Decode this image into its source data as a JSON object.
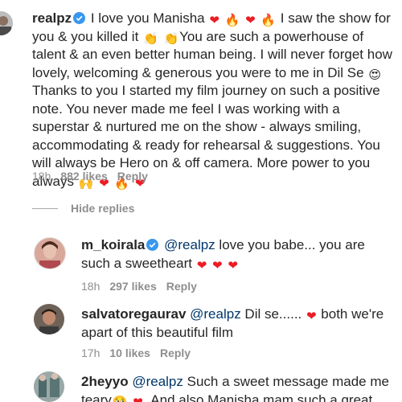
{
  "comment_main": {
    "username": "realpz",
    "body_1": " I love you Manisha ",
    "body_2": " I saw the show for you & you killed it ",
    "body_3": "You are such a powerhouse of talent & an even better human being. I will never forget how lovely, welcoming & generous you were to me in Dil Se ",
    "body_4": "Thanks to you I started my film journey on such a positive note. You never made me feel I was working with a superstar & nurtured me on the show - always smiling, accommodating & ready for rehearsal & suggestions. You will always be Hero on & off camera. More power to you always ",
    "time": "18h",
    "likes": "882 likes",
    "reply": "Reply"
  },
  "hide_replies": "Hide replies",
  "replies": [
    {
      "username": "m_koirala",
      "mention": "@realpz",
      "body": " love you babe... you are such a sweetheart ",
      "time": "18h",
      "likes": "297 likes",
      "reply": "Reply"
    },
    {
      "username": "salvatoregaurav",
      "mention": "@realpz",
      "body_1": " Dil se...... ",
      "body_2": " both we're apart of this beautiful film",
      "time": "17h",
      "likes": "10 likes",
      "reply": "Reply"
    },
    {
      "username": "2heyyo",
      "mention": "@realpz",
      "body_1": " Such a sweet message made me teary",
      "body_2": ". And also Manisha mam such a great"
    }
  ],
  "icons": {
    "heart": "heart-emoji",
    "fire": "fire-emoji",
    "clap": "clapping-hands-emoji",
    "heart_eyes": "smiling-face-with-heart-eyes-emoji",
    "raised_hands": "raising-hands-emoji",
    "teary": "teary-face-emoji",
    "verified": "verified-badge-icon"
  },
  "colors": {
    "heart": "#ed1c24",
    "fire": "#f7931e",
    "mention": "#00376b",
    "meta": "#8e8e8e",
    "verified": "#3897f0"
  }
}
